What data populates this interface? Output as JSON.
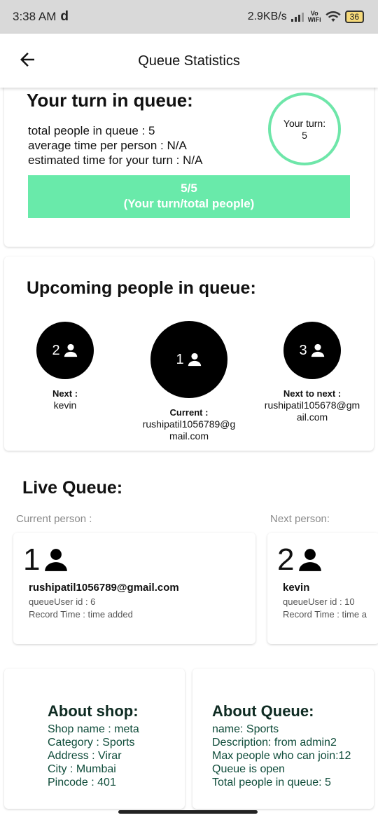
{
  "status_bar": {
    "time": "3:38 AM",
    "carrier_glyph": "d",
    "speed": "2.9KB/s",
    "vowifi_top": "Vo",
    "vowifi_bottom": "WiFi",
    "battery": "36"
  },
  "app_bar": {
    "title": "Queue Statistics",
    "back_icon": "arrow-left-icon"
  },
  "your_turn": {
    "title": "Your turn in queue:",
    "total_people_line": "total people in queue : 5",
    "avg_time_line": "average time per person : N/A",
    "est_time_line": "estimated time for your turn : N/A",
    "circle_label": "Your turn:",
    "circle_value": "5",
    "bar_value": "5/5",
    "bar_caption": "(Your turn/total people)",
    "accent_color": "#69eaaa"
  },
  "upcoming": {
    "title": "Upcoming people in queue:",
    "next": {
      "number": "2",
      "label": "Next :",
      "name": "kevin"
    },
    "current": {
      "number": "1",
      "label": "Current :",
      "name_line1": "rushipatil1056789@g",
      "name_line2": "mail.com"
    },
    "next_to_next": {
      "number": "3",
      "label": "Next to next :",
      "name_line1": "rushipatil105678@gm",
      "name_line2": "ail.com"
    }
  },
  "live_queue": {
    "title": "Live Queue:",
    "current_label": "Current person :",
    "next_label": "Next person:",
    "current_card": {
      "number": "1",
      "email": "rushipatil1056789@gmail.com",
      "user_id": "queueUser id : 6",
      "record_time": "Record Time : time added"
    },
    "next_card": {
      "number": "2",
      "email": "kevin",
      "user_id": "queueUser id : 10",
      "record_time": "Record Time : time a"
    }
  },
  "about_shop": {
    "title": "About shop:",
    "lines": [
      "Shop name : meta",
      "Category : Sports",
      "Address : Virar",
      "City : Mumbai",
      "Pincode : 401"
    ]
  },
  "about_queue": {
    "title": "About Queue:",
    "lines": [
      "name: Sports",
      "Description: from admin2",
      "Max people who can join:12",
      "Queue is open",
      "Total people in queue: 5"
    ]
  }
}
